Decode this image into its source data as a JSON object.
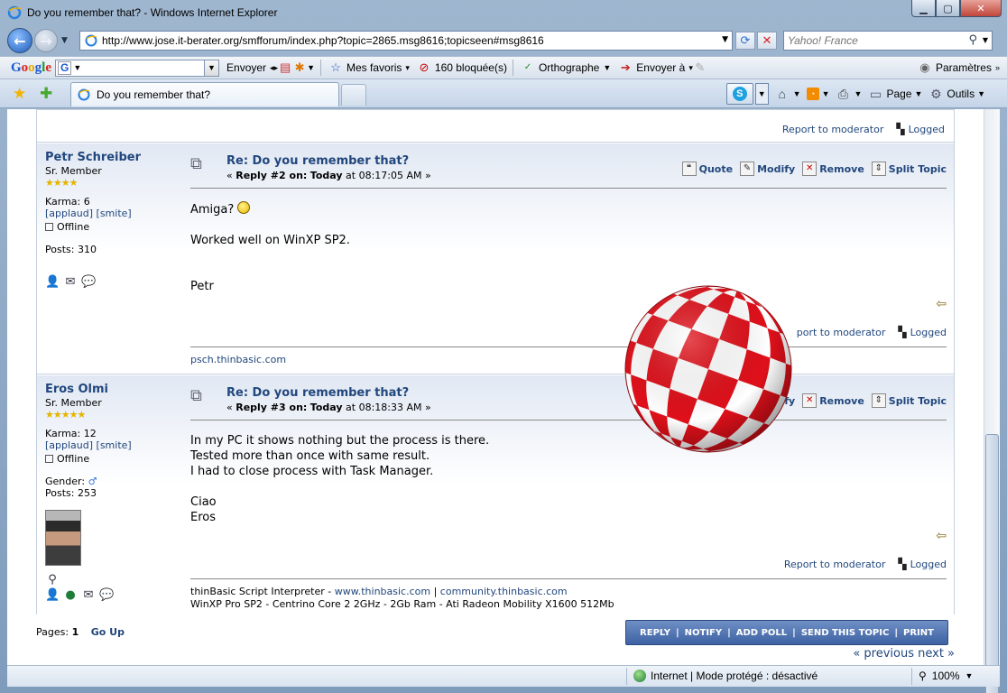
{
  "window": {
    "title": "Do you remember that? - Windows Internet Explorer",
    "url": "http://www.jose.it-berater.org/smfforum/index.php?topic=2865.msg8616;topicseen#msg8616",
    "search_placeholder": "Yahoo! France"
  },
  "google_toolbar": {
    "logo_letters": [
      "G",
      "o",
      "o",
      "g",
      "l",
      "e"
    ],
    "search_badge": "G",
    "send": "Envoyer",
    "favorites": "Mes favoris",
    "blocked": "160 bloquée(s)",
    "spelling": "Orthographe",
    "send_to": "Envoyer à",
    "settings": "Paramètres"
  },
  "tabs": [
    {
      "label": "Do you remember that?"
    }
  ],
  "command_bar": {
    "page": "Page",
    "tools": "Outils"
  },
  "forum": {
    "top_report": "Report to moderator",
    "logged": "Logged",
    "posts": [
      {
        "author": "Petr Schreiber",
        "rank": "Sr. Member",
        "stars": "★★★★",
        "karma": "Karma: 6",
        "applaud": "[applaud] [smite]",
        "status": "Offline",
        "post_count": "Posts: 310",
        "subject": "Re: Do you remember that?",
        "reply_label": "Reply #2 on:",
        "reply_day": "Today",
        "reply_time": "at 08:17:05 AM »",
        "reply_prefix": "«",
        "line1": "Amiga?",
        "line2": "Worked well on WinXP SP2.",
        "line3": "Petr",
        "signature": "psch.thinbasic.com"
      },
      {
        "author": "Eros Olmi",
        "rank": "Sr. Member",
        "stars": "★★★★★",
        "karma": "Karma: 12",
        "applaud": "[applaud] [smite]",
        "status": "Offline",
        "gender": "Gender:",
        "post_count": "Posts: 253",
        "subject": "Re: Do you remember that?",
        "reply_label": "Reply #3 on:",
        "reply_day": "Today",
        "reply_time": "at 08:18:33 AM »",
        "reply_prefix": "«",
        "line1": "In my PC it shows nothing but the process is there.",
        "line2": "Tested more than once with same result.",
        "line3": "I had to close process with Task Manager.",
        "line4": "Ciao",
        "line5": "Eros",
        "sig_prefix": "thinBasic Script Interpreter - ",
        "sig_link1": "www.thinbasic.com",
        "sig_sep": " | ",
        "sig_link2": "community.thinbasic.com",
        "sig_line2": "WinXP Pro SP2 - Centrino Core 2 2GHz - 2Gb Ram - Ati Radeon Mobility X1600 512Mb"
      }
    ],
    "actions": {
      "quote": "Quote",
      "modify": "Modify",
      "remove": "Remove",
      "split": "Split Topic",
      "modify_partial": "dify"
    },
    "pages_label": "Pages:",
    "current_page": "1",
    "go_up": "Go Up",
    "buttons": [
      "REPLY",
      "NOTIFY",
      "ADD POLL",
      "SEND THIS TOPIC",
      "PRINT"
    ],
    "prev_next": "« previous next »",
    "report_partial": "port to moderator"
  },
  "status_bar": {
    "zone": "Internet | Mode protégé : désactivé",
    "zoom": "100%"
  },
  "colors": {
    "link": "#21477d",
    "ball_red": "#e0101a",
    "button_bar": "#4a6fb0"
  }
}
